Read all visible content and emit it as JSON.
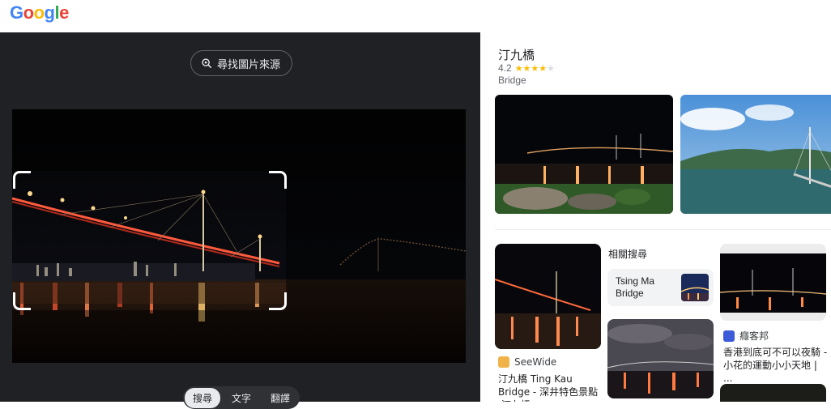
{
  "app": {
    "logo": "Google"
  },
  "lens": {
    "find_source_label": "尋找圖片來源",
    "tabs": [
      {
        "label": "搜尋",
        "active": true
      },
      {
        "label": "文字",
        "active": false
      },
      {
        "label": "翻譯",
        "active": false
      }
    ]
  },
  "knowledge_panel": {
    "title": "汀九橋",
    "rating": "4.2",
    "stars_filled": 4,
    "stars_total": 5,
    "type": "Bridge"
  },
  "results": {
    "related_title": "相關搜尋",
    "related_chip": "Tsing Ma Bridge",
    "cards": [
      {
        "source": "SeeWide",
        "caption": "汀九橋 Ting Kau Bridge - 深井特色景點 ,汀九橋..."
      },
      {
        "source": "癮客邦",
        "caption": "香港到底可不可以夜騎 - 小花的運動小小天地 | ..."
      }
    ]
  },
  "colors": {
    "google_blue": "#4285F4",
    "google_red": "#EA4335",
    "google_yellow": "#FBBC05",
    "google_green": "#34A853",
    "dark_panel": "#202124",
    "star": "#fbbc04"
  }
}
